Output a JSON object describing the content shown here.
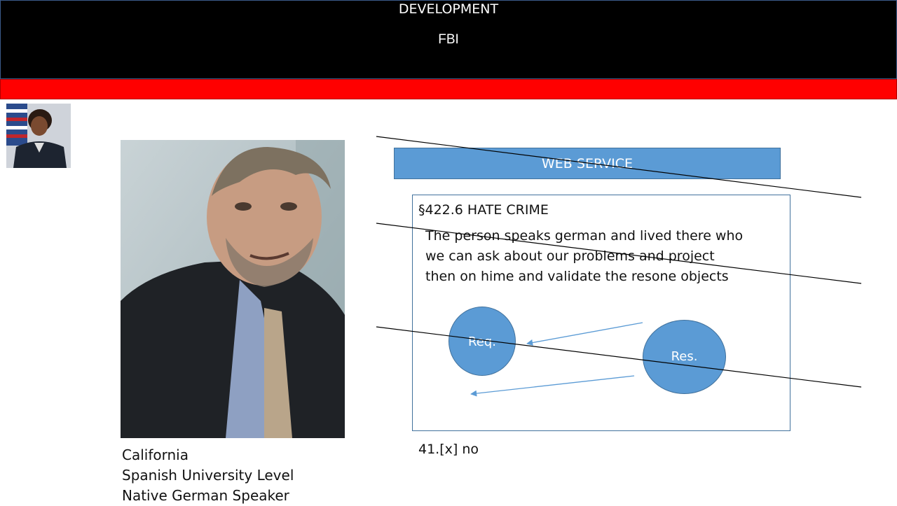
{
  "header": {
    "title": "FBI"
  },
  "banner": {
    "title": "DEVELOPMENT"
  },
  "bio": {
    "lines": [
      "California",
      "Spanish University Level",
      "Native German Speaker"
    ]
  },
  "web_service": {
    "label": "WEB SERVICE"
  },
  "crime": {
    "title": "§422.6 HATE CRIME",
    "text_lines": [
      "The person speaks german and lived there who",
      "we can ask about our problems and project",
      "then on hime and validate the resone objects"
    ]
  },
  "diagram": {
    "req_label": "Req.",
    "res_label": "Res."
  },
  "footer": {
    "note": "41.[x]  no"
  },
  "colors": {
    "header_bg": "#000000",
    "banner_bg": "#ff0000",
    "accent_blue": "#5b9bd5"
  },
  "images": {
    "small_photo": "portrait-photo",
    "main_photo": "selfie-photo"
  }
}
